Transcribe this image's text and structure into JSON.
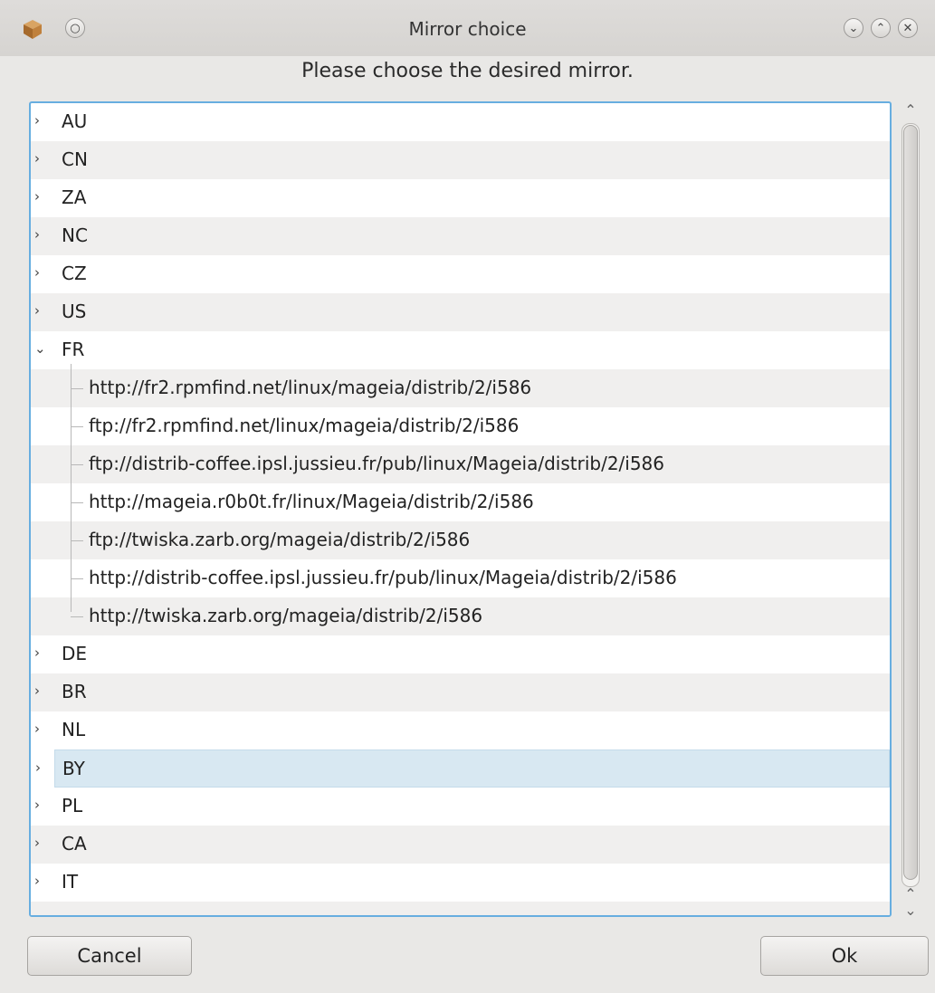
{
  "window": {
    "title": "Mirror choice",
    "prompt": "Please choose the desired mirror."
  },
  "titlebar_buttons": {
    "menu_icon": "○",
    "minimize_icon": "⌄",
    "maximize_icon": "⌃",
    "close_icon": "✕"
  },
  "tree": {
    "countries": [
      "AU",
      "CN",
      "ZA",
      "NC",
      "CZ",
      "US",
      "FR",
      "DE",
      "BR",
      "NL",
      "BY",
      "PL",
      "CA",
      "IT"
    ],
    "expanded_country": "FR",
    "selected_country": "BY",
    "fr_mirrors": [
      "http://fr2.rpmfind.net/linux/mageia/distrib/2/i586",
      "ftp://fr2.rpmfind.net/linux/mageia/distrib/2/i586",
      "ftp://distrib-coffee.ipsl.jussieu.fr/pub/linux/Mageia/distrib/2/i586",
      "http://mageia.r0b0t.fr/linux/Mageia/distrib/2/i586",
      "ftp://twiska.zarb.org/mageia/distrib/2/i586",
      "http://distrib-coffee.ipsl.jussieu.fr/pub/linux/Mageia/distrib/2/i586",
      "http://twiska.zarb.org/mageia/distrib/2/i586"
    ]
  },
  "buttons": {
    "cancel": "Cancel",
    "ok": "Ok"
  },
  "colors": {
    "focus_border": "#67aee0",
    "selection": "#d8e8f2"
  }
}
